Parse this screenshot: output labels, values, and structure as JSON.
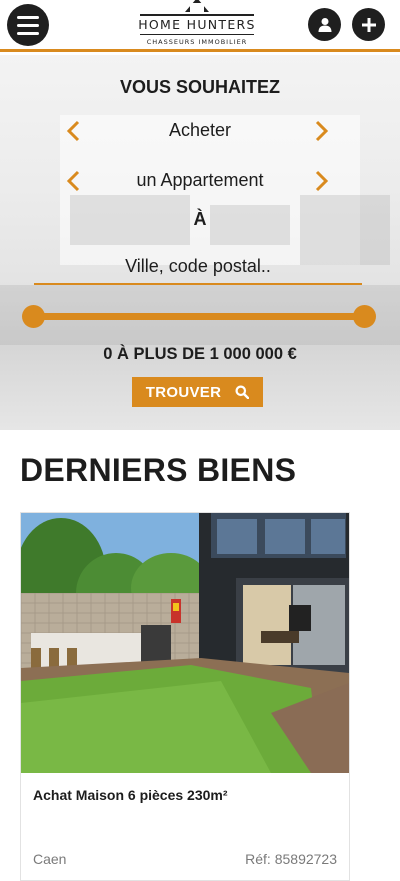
{
  "header": {
    "logo_title": "HOME HUNTERS",
    "logo_subtitle": "CHASSEURS IMMOBILIER",
    "menu_icon": "hamburger-icon",
    "user_icon": "user-icon",
    "add_icon": "plus-icon"
  },
  "search": {
    "title": "VOUS SOUHAITEZ",
    "transaction_type": "Acheter",
    "property_type": "un Appartement",
    "location_label": "À",
    "location_placeholder": "Ville, code postal..",
    "price_range": "0 À PLUS DE 1 000 000 €",
    "price_slider": {
      "min_fraction": 0,
      "max_fraction": 1
    },
    "submit_label": "TROUVER"
  },
  "listings": {
    "section_title": "DERNIERS BIENS",
    "items": [
      {
        "title": "Achat Maison 6 pièces 230m²",
        "city": "Caen",
        "reference": "Réf: 85892723"
      }
    ]
  },
  "colors": {
    "accent": "#d98a1e",
    "dark": "#1f1f1f",
    "text": "#1d1d1d",
    "muted": "#7a7a7a"
  }
}
